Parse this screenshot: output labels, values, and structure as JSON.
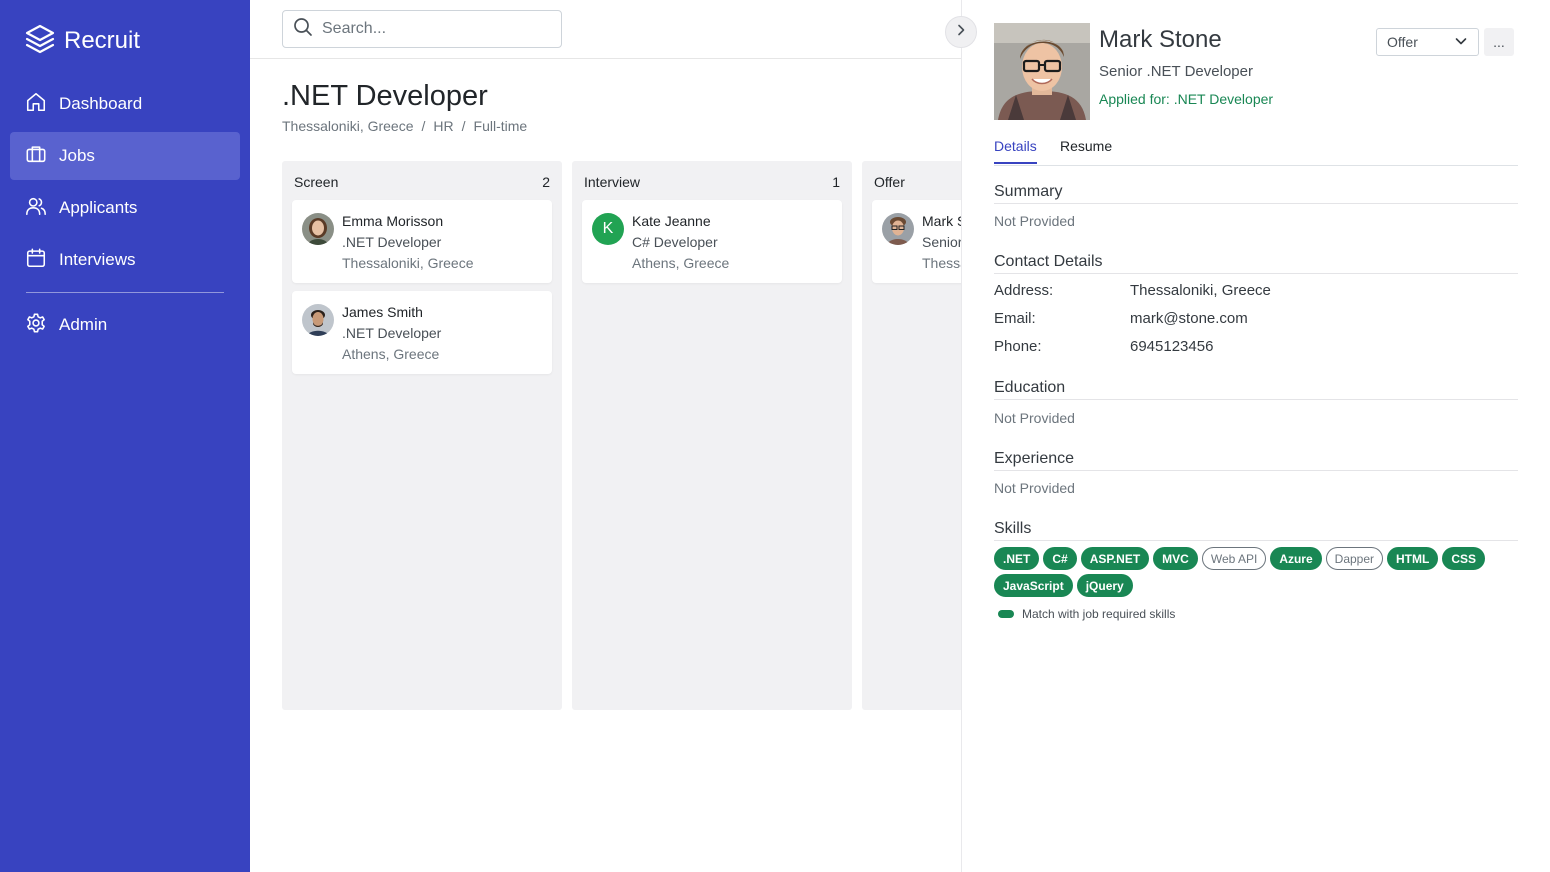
{
  "app": {
    "brand": "Recruit"
  },
  "sidebar": {
    "items": [
      {
        "label": "Dashboard",
        "icon": "home-icon"
      },
      {
        "label": "Jobs",
        "icon": "briefcase-icon",
        "active": true
      },
      {
        "label": "Applicants",
        "icon": "users-icon"
      },
      {
        "label": "Interviews",
        "icon": "calendar-icon"
      },
      {
        "label": "Admin",
        "icon": "gear-icon"
      }
    ]
  },
  "search": {
    "placeholder": "Search..."
  },
  "job": {
    "title": ".NET Developer",
    "location": "Thessaloniki, Greece",
    "department": "HR",
    "type": "Full-time",
    "sep": "/"
  },
  "board": {
    "columns": [
      {
        "name": "Screen",
        "count": "2",
        "cards": [
          {
            "name": "Emma Morisson",
            "role": ".NET Developer",
            "location": "Thessaloniki, Greece"
          },
          {
            "name": "James Smith",
            "role": ".NET Developer",
            "location": "Athens, Greece"
          }
        ]
      },
      {
        "name": "Interview",
        "count": "1",
        "cards": [
          {
            "name": "Kate Jeanne",
            "role": "C# Developer",
            "location": "Athens, Greece",
            "initial": "K"
          }
        ]
      },
      {
        "name": "Offer",
        "count": "",
        "cards": [
          {
            "name": "Mark Stone",
            "role": "Senior .NET Developer",
            "location": "Thessaloniki, Greece"
          }
        ]
      }
    ]
  },
  "applicant": {
    "name": "Mark Stone",
    "title": "Senior .NET Developer",
    "applied_for": "Applied for: .NET Developer",
    "status": "Offer",
    "more": "...",
    "tabs": [
      "Details",
      "Resume"
    ],
    "summary": {
      "heading": "Summary",
      "value": "Not Provided"
    },
    "contact": {
      "heading": "Contact Details",
      "address_label": "Address:",
      "address": "Thessaloniki, Greece",
      "email_label": "Email:",
      "email": "mark@stone.com",
      "phone_label": "Phone:",
      "phone": "6945123456"
    },
    "education": {
      "heading": "Education",
      "value": "Not Provided"
    },
    "experience": {
      "heading": "Experience",
      "value": "Not Provided"
    },
    "skills": {
      "heading": "Skills",
      "items": [
        {
          "label": ".NET",
          "match": true
        },
        {
          "label": "C#",
          "match": true
        },
        {
          "label": "ASP.NET",
          "match": true
        },
        {
          "label": "MVC",
          "match": true
        },
        {
          "label": "Web API",
          "match": false
        },
        {
          "label": "Azure",
          "match": true
        },
        {
          "label": "Dapper",
          "match": false
        },
        {
          "label": "HTML",
          "match": true
        },
        {
          "label": "CSS",
          "match": true
        },
        {
          "label": "JavaScript",
          "match": true
        },
        {
          "label": "jQuery",
          "match": true
        }
      ],
      "legend": "Match with job required skills"
    }
  },
  "colors": {
    "sidebar": "#3843c0",
    "active_nav": "#5962cf",
    "match": "#198754",
    "accent": "#3843c0"
  }
}
